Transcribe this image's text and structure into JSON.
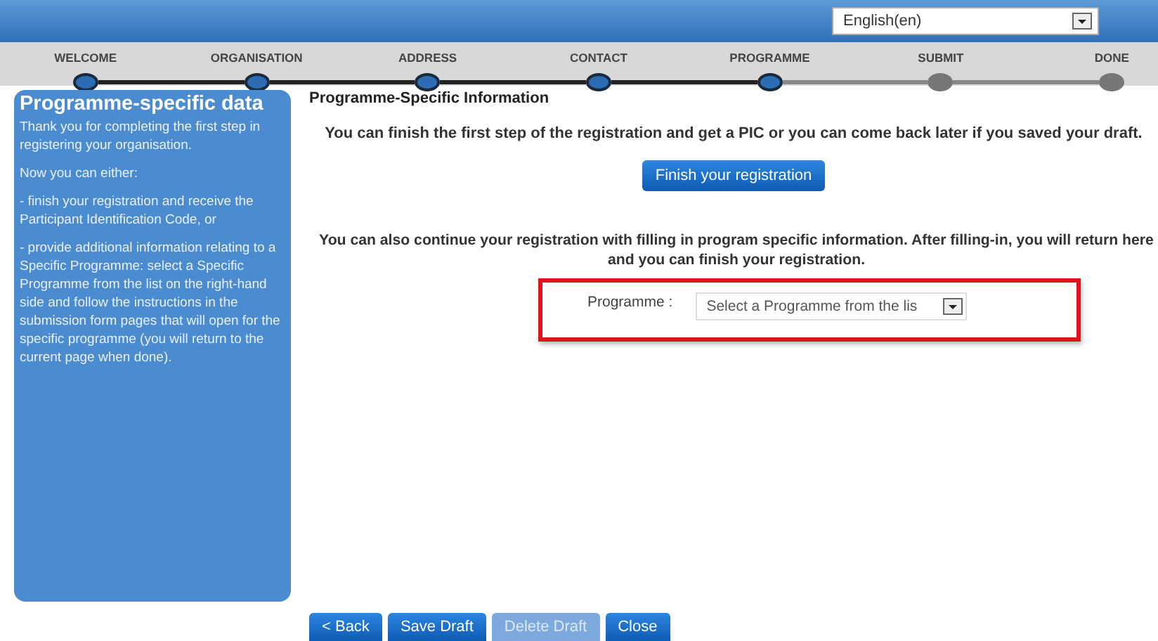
{
  "language_select": {
    "value": "English(en)"
  },
  "steps": [
    {
      "label": "WELCOME",
      "reached": true
    },
    {
      "label": "ORGANISATION",
      "reached": true
    },
    {
      "label": "ADDRESS",
      "reached": true
    },
    {
      "label": "CONTACT",
      "reached": true
    },
    {
      "label": "PROGRAMME",
      "reached": true
    },
    {
      "label": "SUBMIT",
      "reached": false
    },
    {
      "label": "DONE",
      "reached": false
    }
  ],
  "sidebar": {
    "title": "Programme-specific data",
    "paragraphs": [
      "Thank you for completing the first step in registering your organisation.",
      "Now you can either:",
      "- finish your registration and receive the Participant Identification Code, or",
      "- provide additional information relating to a Specific Programme: select a Specific Programme from the list on the right-hand side and follow the instructions in the submission form pages that will open for the specific programme (you will return to the current page when done)."
    ]
  },
  "content": {
    "heading": "Programme-Specific Information",
    "intro": "You can finish the first step of the registration and get a PIC or you can come back later if you saved your draft.",
    "finish_button": "Finish your registration",
    "continue_text": "You can also continue your registration with filling in program specific information. After filling-in, you will return here and you can finish your registration.",
    "programme_label": "Programme :",
    "programme_select": "Select a Programme from the lis"
  },
  "buttons": [
    {
      "label": "< Back",
      "disabled": false
    },
    {
      "label": "Save Draft",
      "disabled": false
    },
    {
      "label": "Delete Draft",
      "disabled": true
    },
    {
      "label": "Close",
      "disabled": false
    }
  ]
}
